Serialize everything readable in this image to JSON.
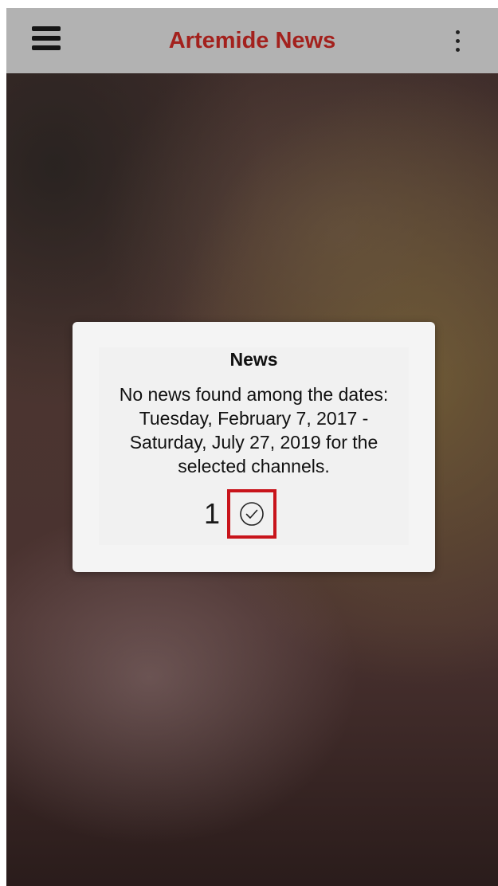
{
  "app_bar": {
    "title": "Artemide News",
    "menu_icon": "hamburger-menu-icon",
    "more_icon": "more-vertical-icon",
    "background_color": "#b2b2b2",
    "title_color": "#a3211d"
  },
  "dialog": {
    "title": "News",
    "message": "No news found among the dates: Tuesday, February 7, 2017 - Saturday, July 27, 2019 for the selected channels.",
    "ok_count": "1",
    "ok_icon": "check-circle-icon",
    "highlight_color": "#c8141b"
  }
}
